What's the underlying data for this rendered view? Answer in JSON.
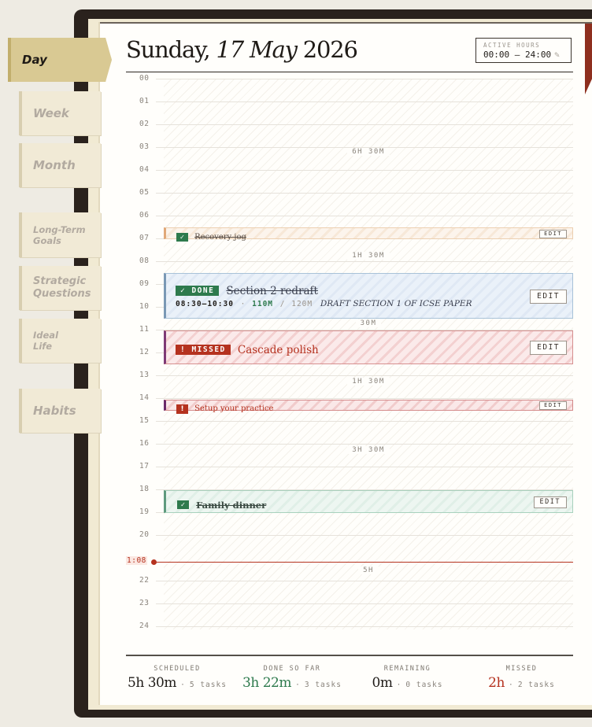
{
  "nav": {
    "tabs": [
      {
        "label": "Day"
      },
      {
        "label": "Week"
      },
      {
        "label": "Month"
      },
      {
        "label": "Long-Term Goals"
      },
      {
        "label": "Strategic Questions"
      },
      {
        "label": "Ideal Life"
      },
      {
        "label": "Habits"
      }
    ]
  },
  "header": {
    "weekday": "Sunday,",
    "daymonth": "17 May",
    "year": "2026",
    "active_hours_label": "ACTIVE HOURS",
    "active_hours_value": "00:00 – 24:00",
    "edit_icon": "pencil-icon"
  },
  "timeline": {
    "hours": [
      "00",
      "01",
      "02",
      "03",
      "04",
      "05",
      "06",
      "07",
      "08",
      "09",
      "10",
      "11",
      "12",
      "13",
      "14",
      "15",
      "16",
      "17",
      "18",
      "19",
      "20",
      "21",
      "22",
      "23",
      "24"
    ],
    "gaps": [
      "6H 30M",
      "1H 30M",
      "30M",
      "1H 30M",
      "3H 30M",
      "5H"
    ],
    "now_label": "1:08"
  },
  "blocks": {
    "jog": {
      "title": "Recovery jog",
      "check": "✓",
      "edit": "EDIT"
    },
    "redraft": {
      "badge": "✓ DONE",
      "title": "Section 2 redraft",
      "time": "08:30–10:30",
      "sep1": "·",
      "actual": "110M",
      "sep2": "/",
      "planned": "120M",
      "note": "DRAFT SECTION 1 OF ICSE PAPER",
      "edit": "EDIT"
    },
    "cascade": {
      "badge": "! MISSED",
      "title": "Cascade polish",
      "edit": "EDIT"
    },
    "setup": {
      "bang": "!",
      "title": "Setup your practice",
      "edit": "EDIT"
    },
    "dinner": {
      "check": "✓",
      "title": "Family dinner",
      "edit": "EDIT"
    }
  },
  "stats": [
    {
      "label": "SCHEDULED",
      "value": "5h 30m",
      "dot": "·",
      "sub": "5 tasks",
      "color": "#1f1b17"
    },
    {
      "label": "DONE SO FAR",
      "value": "3h 22m",
      "dot": "·",
      "sub": "3 tasks",
      "color": "#2e7a4d"
    },
    {
      "label": "REMAINING",
      "value": "0m",
      "dot": "·",
      "sub": "0 tasks",
      "color": "#1f1b17"
    },
    {
      "label": "MISSED",
      "value": "2h",
      "dot": "·",
      "sub": "2 tasks",
      "color": "#b5321f"
    }
  ],
  "colors": {
    "accent_done": "#2e7a4d",
    "accent_missed": "#b5321f",
    "ribbon": "#8e2f1f"
  }
}
